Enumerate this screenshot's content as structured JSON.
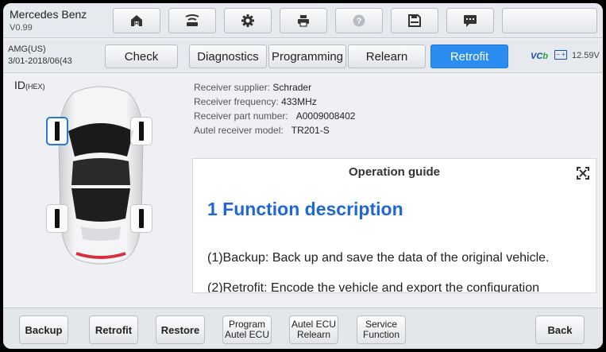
{
  "header": {
    "vehicle_name": "Mercedes Benz",
    "version": "V0.99",
    "icons": [
      "home-icon",
      "vci-link-icon",
      "settings-icon",
      "print-icon",
      "help-icon",
      "save-icon",
      "message-icon"
    ]
  },
  "tabbar": {
    "model": "AMG(US)",
    "years": "3/01-2018/06(43",
    "tabs": [
      "Check",
      "Diagnostics",
      "Programming",
      "Relearn",
      "Retrofit"
    ],
    "active_tab": "Retrofit",
    "vci_label": "VC",
    "vci_suffix": "b",
    "battery_voltage": "12.59V"
  },
  "sensor_panel": {
    "id_label": "ID",
    "id_unit": "(HEX)",
    "selected_tire": "front-left"
  },
  "receiver_info": {
    "supplier_label": "Receiver supplier:",
    "supplier_value": "Schrader",
    "frequency_label": "Receiver frequency:",
    "frequency_value": "433MHz",
    "part_number_label": "Receiver part number:",
    "part_number_value": "A0009008402",
    "model_label": "Autel receiver model:",
    "model_value": "TR201-S"
  },
  "guide": {
    "title": "Operation guide",
    "heading": "1 Function description",
    "para1": "(1)Backup: Back up and save the data of the original vehicle.",
    "para2": "(2)Retrofit: Encode the vehicle and export the configuration"
  },
  "bottom": {
    "backup": "Backup",
    "retrofit": "Retrofit",
    "restore": "Restore",
    "program_l1": "Program",
    "program_l2": "Autel ECU",
    "relearn_l1": "Autel ECU",
    "relearn_l2": "Relearn",
    "service_l1": "Service",
    "service_l2": "Function",
    "back": "Back"
  },
  "colors": {
    "accent": "#2b8df0",
    "heading_blue": "#1f66d6",
    "vci_green": "#27a34a"
  }
}
